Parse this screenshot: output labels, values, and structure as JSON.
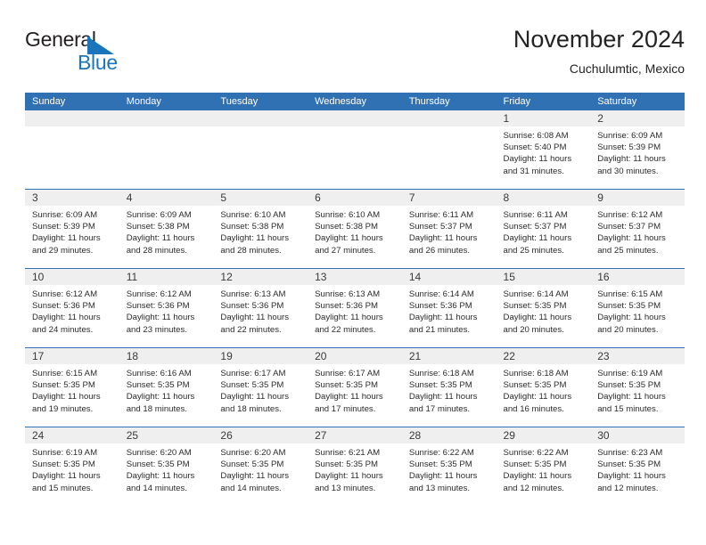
{
  "brand": {
    "name_part1": "General",
    "name_part2": "Blue",
    "mark": "triangle-flag-icon",
    "accent_color": "#1b75bb"
  },
  "header": {
    "title": "November 2024",
    "subtitle": "Cuchulumtic, Mexico"
  },
  "theme": {
    "header_blue": "#3071b4",
    "date_band_gray": "#efefef",
    "text_color": "#2b2b2b"
  },
  "calendar": {
    "weekday_headers": [
      "Sunday",
      "Monday",
      "Tuesday",
      "Wednesday",
      "Thursday",
      "Friday",
      "Saturday"
    ],
    "weeks": [
      [
        {
          "date": "",
          "empty": true,
          "lines": []
        },
        {
          "date": "",
          "empty": true,
          "lines": []
        },
        {
          "date": "",
          "empty": true,
          "lines": []
        },
        {
          "date": "",
          "empty": true,
          "lines": []
        },
        {
          "date": "",
          "empty": true,
          "lines": []
        },
        {
          "date": "1",
          "empty": false,
          "lines": [
            "Sunrise: 6:08 AM",
            "Sunset: 5:40 PM",
            "Daylight: 11 hours",
            "and 31 minutes."
          ]
        },
        {
          "date": "2",
          "empty": false,
          "lines": [
            "Sunrise: 6:09 AM",
            "Sunset: 5:39 PM",
            "Daylight: 11 hours",
            "and 30 minutes."
          ]
        }
      ],
      [
        {
          "date": "3",
          "empty": false,
          "lines": [
            "Sunrise: 6:09 AM",
            "Sunset: 5:39 PM",
            "Daylight: 11 hours",
            "and 29 minutes."
          ]
        },
        {
          "date": "4",
          "empty": false,
          "lines": [
            "Sunrise: 6:09 AM",
            "Sunset: 5:38 PM",
            "Daylight: 11 hours",
            "and 28 minutes."
          ]
        },
        {
          "date": "5",
          "empty": false,
          "lines": [
            "Sunrise: 6:10 AM",
            "Sunset: 5:38 PM",
            "Daylight: 11 hours",
            "and 28 minutes."
          ]
        },
        {
          "date": "6",
          "empty": false,
          "lines": [
            "Sunrise: 6:10 AM",
            "Sunset: 5:38 PM",
            "Daylight: 11 hours",
            "and 27 minutes."
          ]
        },
        {
          "date": "7",
          "empty": false,
          "lines": [
            "Sunrise: 6:11 AM",
            "Sunset: 5:37 PM",
            "Daylight: 11 hours",
            "and 26 minutes."
          ]
        },
        {
          "date": "8",
          "empty": false,
          "lines": [
            "Sunrise: 6:11 AM",
            "Sunset: 5:37 PM",
            "Daylight: 11 hours",
            "and 25 minutes."
          ]
        },
        {
          "date": "9",
          "empty": false,
          "lines": [
            "Sunrise: 6:12 AM",
            "Sunset: 5:37 PM",
            "Daylight: 11 hours",
            "and 25 minutes."
          ]
        }
      ],
      [
        {
          "date": "10",
          "empty": false,
          "lines": [
            "Sunrise: 6:12 AM",
            "Sunset: 5:36 PM",
            "Daylight: 11 hours",
            "and 24 minutes."
          ]
        },
        {
          "date": "11",
          "empty": false,
          "lines": [
            "Sunrise: 6:12 AM",
            "Sunset: 5:36 PM",
            "Daylight: 11 hours",
            "and 23 minutes."
          ]
        },
        {
          "date": "12",
          "empty": false,
          "lines": [
            "Sunrise: 6:13 AM",
            "Sunset: 5:36 PM",
            "Daylight: 11 hours",
            "and 22 minutes."
          ]
        },
        {
          "date": "13",
          "empty": false,
          "lines": [
            "Sunrise: 6:13 AM",
            "Sunset: 5:36 PM",
            "Daylight: 11 hours",
            "and 22 minutes."
          ]
        },
        {
          "date": "14",
          "empty": false,
          "lines": [
            "Sunrise: 6:14 AM",
            "Sunset: 5:36 PM",
            "Daylight: 11 hours",
            "and 21 minutes."
          ]
        },
        {
          "date": "15",
          "empty": false,
          "lines": [
            "Sunrise: 6:14 AM",
            "Sunset: 5:35 PM",
            "Daylight: 11 hours",
            "and 20 minutes."
          ]
        },
        {
          "date": "16",
          "empty": false,
          "lines": [
            "Sunrise: 6:15 AM",
            "Sunset: 5:35 PM",
            "Daylight: 11 hours",
            "and 20 minutes."
          ]
        }
      ],
      [
        {
          "date": "17",
          "empty": false,
          "lines": [
            "Sunrise: 6:15 AM",
            "Sunset: 5:35 PM",
            "Daylight: 11 hours",
            "and 19 minutes."
          ]
        },
        {
          "date": "18",
          "empty": false,
          "lines": [
            "Sunrise: 6:16 AM",
            "Sunset: 5:35 PM",
            "Daylight: 11 hours",
            "and 18 minutes."
          ]
        },
        {
          "date": "19",
          "empty": false,
          "lines": [
            "Sunrise: 6:17 AM",
            "Sunset: 5:35 PM",
            "Daylight: 11 hours",
            "and 18 minutes."
          ]
        },
        {
          "date": "20",
          "empty": false,
          "lines": [
            "Sunrise: 6:17 AM",
            "Sunset: 5:35 PM",
            "Daylight: 11 hours",
            "and 17 minutes."
          ]
        },
        {
          "date": "21",
          "empty": false,
          "lines": [
            "Sunrise: 6:18 AM",
            "Sunset: 5:35 PM",
            "Daylight: 11 hours",
            "and 17 minutes."
          ]
        },
        {
          "date": "22",
          "empty": false,
          "lines": [
            "Sunrise: 6:18 AM",
            "Sunset: 5:35 PM",
            "Daylight: 11 hours",
            "and 16 minutes."
          ]
        },
        {
          "date": "23",
          "empty": false,
          "lines": [
            "Sunrise: 6:19 AM",
            "Sunset: 5:35 PM",
            "Daylight: 11 hours",
            "and 15 minutes."
          ]
        }
      ],
      [
        {
          "date": "24",
          "empty": false,
          "lines": [
            "Sunrise: 6:19 AM",
            "Sunset: 5:35 PM",
            "Daylight: 11 hours",
            "and 15 minutes."
          ]
        },
        {
          "date": "25",
          "empty": false,
          "lines": [
            "Sunrise: 6:20 AM",
            "Sunset: 5:35 PM",
            "Daylight: 11 hours",
            "and 14 minutes."
          ]
        },
        {
          "date": "26",
          "empty": false,
          "lines": [
            "Sunrise: 6:20 AM",
            "Sunset: 5:35 PM",
            "Daylight: 11 hours",
            "and 14 minutes."
          ]
        },
        {
          "date": "27",
          "empty": false,
          "lines": [
            "Sunrise: 6:21 AM",
            "Sunset: 5:35 PM",
            "Daylight: 11 hours",
            "and 13 minutes."
          ]
        },
        {
          "date": "28",
          "empty": false,
          "lines": [
            "Sunrise: 6:22 AM",
            "Sunset: 5:35 PM",
            "Daylight: 11 hours",
            "and 13 minutes."
          ]
        },
        {
          "date": "29",
          "empty": false,
          "lines": [
            "Sunrise: 6:22 AM",
            "Sunset: 5:35 PM",
            "Daylight: 11 hours",
            "and 12 minutes."
          ]
        },
        {
          "date": "30",
          "empty": false,
          "lines": [
            "Sunrise: 6:23 AM",
            "Sunset: 5:35 PM",
            "Daylight: 11 hours",
            "and 12 minutes."
          ]
        }
      ]
    ]
  }
}
